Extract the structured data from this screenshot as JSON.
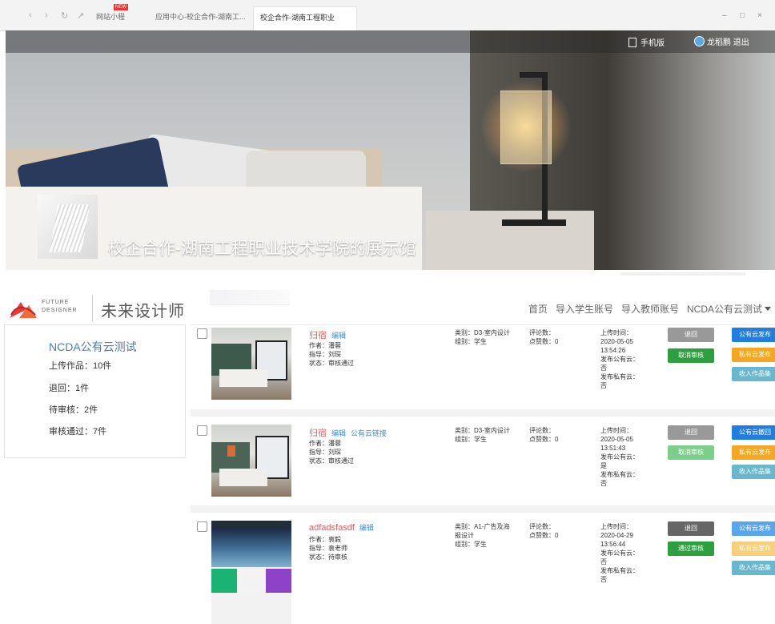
{
  "browser": {
    "tabs": [
      {
        "label": "网站小程"
      },
      {
        "label": "应用中心-校企合作-湖南工..."
      },
      {
        "label": "校企合作-湖南工程职业技..."
      }
    ],
    "new_badge": "NEW"
  },
  "banner": {
    "title": "校企合作-湖南工程职业技术学院的展示馆",
    "mobile_label": "手机版",
    "user_name": "龙稻鹏",
    "logout_label": "退出"
  },
  "header": {
    "logo_en_1": "FUTURE",
    "logo_en_2": "DESIGNER",
    "logo_cn": "未来设计师",
    "nav": [
      "首页",
      "导入学生账号",
      "导入教师账号",
      "NCDA公有云测试"
    ]
  },
  "sidebar": {
    "title": "NCDA公有云测试",
    "items": [
      "上传作品：10件",
      "退回：1件",
      "待审核：2件",
      "审核通过：7件"
    ]
  },
  "works": [
    {
      "title": "归宿",
      "links": [
        "编辑"
      ],
      "author": "作者：潘蓉",
      "advisor": "指导：刘琛",
      "status": "状态：审核通过",
      "category": "类别：D3-室内设计",
      "group": "组别：学生",
      "comments": "评论数：",
      "likes": "点赞数：0",
      "upload_label": "上传时间：",
      "upload_date": "2020-05-05",
      "upload_time": "13:54:26",
      "public_label": "发布公有云：",
      "public_value": "否",
      "private_label": "发布私有云：",
      "private_value": "否",
      "buttons_left": [
        "退回",
        "取消审核"
      ],
      "buttons_right": [
        "公有云发布",
        "私有云发布",
        "收入作品集"
      ]
    },
    {
      "title": "归宿",
      "links": [
        "编辑",
        "公有云链接"
      ],
      "author": "作者：潘蓉",
      "advisor": "指导：刘琛",
      "status": "状态：审核通过",
      "category": "类别：D3-室内设计",
      "group": "组别：学生",
      "comments": "评论数：",
      "likes": "点赞数：0",
      "upload_label": "上传时间：",
      "upload_date": "2020-05-05",
      "upload_time": "13:51:43",
      "public_label": "发布公有云：",
      "public_value": "是",
      "private_label": "发布私有云：",
      "private_value": "否",
      "buttons_left": [
        "退回",
        "取消审核"
      ],
      "buttons_right": [
        "公有云撤回",
        "私有云发布",
        "收入作品集"
      ]
    },
    {
      "title": "adfadsfasdf",
      "links": [
        "编辑"
      ],
      "author": "作者：袁毅",
      "advisor": "指导：袁老师",
      "status": "状态：待审核",
      "category": "类别：A1-广告及海报设计",
      "group": "组别：学生",
      "comments": "评论数：",
      "likes": "点赞数：0",
      "upload_label": "上传时间：",
      "upload_date": "2020-04-29",
      "upload_time": "13:56:44",
      "public_label": "发布公有云：",
      "public_value": "否",
      "private_label": "发布私有云：",
      "private_value": "否",
      "buttons_left": [
        "退回",
        "通过审核"
      ],
      "buttons_right": [
        "公有云发布",
        "私有云发布",
        "收入作品集"
      ]
    }
  ]
}
